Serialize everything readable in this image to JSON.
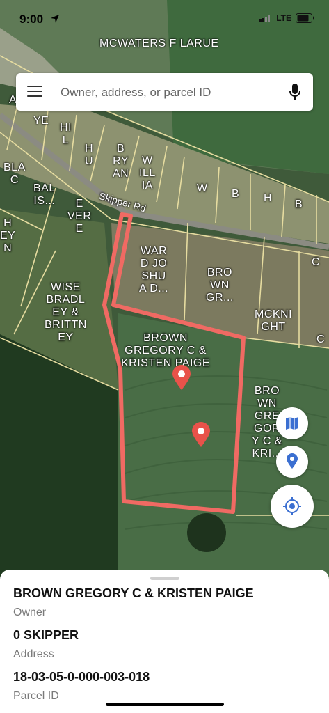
{
  "status_bar": {
    "time": "9:00",
    "network": "LTE"
  },
  "search": {
    "placeholder": "Owner, address, or parcel ID"
  },
  "map": {
    "road_label": "Skipper Rd",
    "parcels": [
      "MCWATERS F LARUE",
      "YE",
      "A",
      "HI\nL",
      "H\nU",
      "B\nRY\nAN",
      "W\nILL\nIA",
      "W",
      "B",
      "H",
      "B",
      "BLA\nC",
      "BAL\nIS...",
      "E\nVER\nE",
      "H\nEY\nN",
      "WAR\nD JO\nSHU\nA D...",
      "BRO\nWN\nGR...",
      "C",
      "WISE\nBRADL\nEY &\nBRITTN\nEY",
      "MCKNI\nGHT",
      "C",
      "BROWN\nGREGORY C &\nKRISTEN PAIGE",
      "BRO\nWN\nGRE\nGOR\nY C &\nKRI..."
    ]
  },
  "details": {
    "owner_value": "BROWN GREGORY C & KRISTEN PAIGE",
    "owner_label": "Owner",
    "address_value": "0 SKIPPER",
    "address_label": "Address",
    "parcel_value": "18-03-05-0-000-003-018",
    "parcel_label": "Parcel ID"
  },
  "colors": {
    "highlight": "#f06a63",
    "pin": "#e8524a",
    "fab_icon": "#3b6fd1",
    "parcel_line": "#e6dca0"
  }
}
